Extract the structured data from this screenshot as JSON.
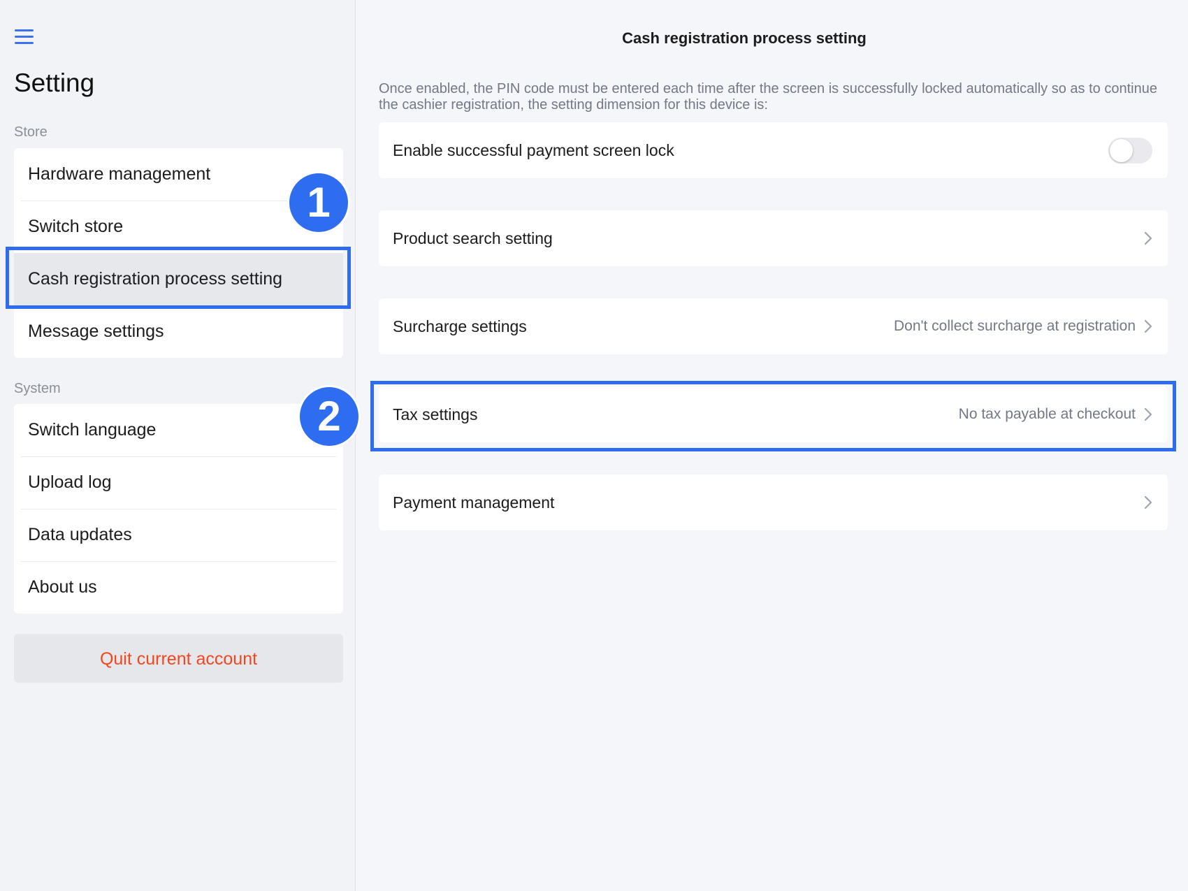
{
  "sidebar": {
    "title": "Setting",
    "sections": {
      "store": {
        "label": "Store",
        "items": [
          {
            "label": "Hardware management"
          },
          {
            "label": "Switch store"
          },
          {
            "label": "Cash registration process setting"
          },
          {
            "label": "Message settings"
          }
        ]
      },
      "system": {
        "label": "System",
        "items": [
          {
            "label": "Switch language"
          },
          {
            "label": "Upload log"
          },
          {
            "label": "Data updates"
          },
          {
            "label": "About us"
          }
        ]
      }
    },
    "quit_label": "Quit current account",
    "active_item": "Cash registration process setting"
  },
  "main": {
    "title": "Cash registration process setting",
    "description": "Once enabled, the PIN code must be entered each time after the screen is successfully locked automatically so as to continue the cashier registration, the setting dimension for this device is:",
    "rows": {
      "screen_lock": {
        "label": "Enable successful payment screen lock",
        "enabled": false
      },
      "product_search": {
        "label": "Product search setting",
        "value": ""
      },
      "surcharge": {
        "label": "Surcharge settings",
        "value": "Don't collect surcharge at registration"
      },
      "tax": {
        "label": "Tax settings",
        "value": "No tax payable at checkout"
      },
      "payment": {
        "label": "Payment management",
        "value": ""
      }
    }
  },
  "annotations": {
    "badge_1": "1",
    "badge_2": "2"
  },
  "colors": {
    "accent": "#2f6df0",
    "menu_icon": "#3b6ff5",
    "danger": "#f2461f",
    "muted_text": "#727885"
  }
}
